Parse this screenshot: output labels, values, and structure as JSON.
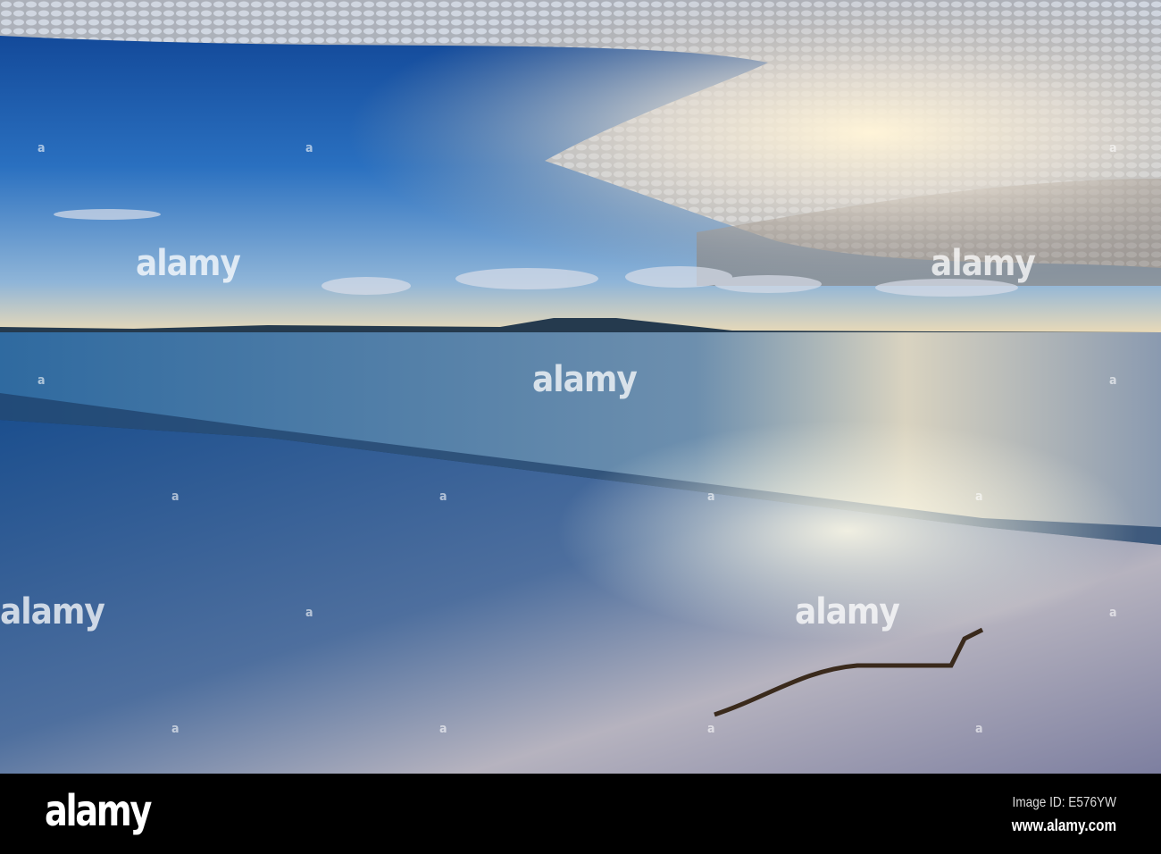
{
  "watermark": {
    "text": "alamy",
    "mark": "a"
  },
  "footer": {
    "logo": "alamy",
    "image_id": "Image ID: E576YW",
    "url": "www.alamy.com"
  },
  "colors": {
    "sky_blue": "#1f5fae",
    "sun_glow": "#f3d9a0",
    "sea": "#3c6d9c",
    "sand": "#8a8fb0"
  }
}
